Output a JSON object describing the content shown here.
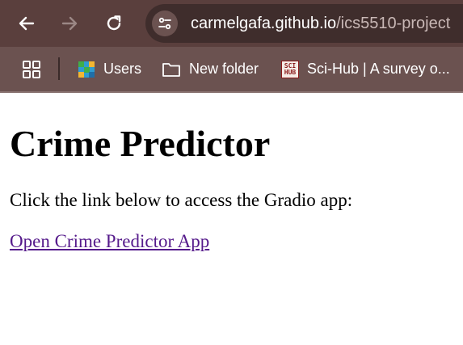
{
  "browser": {
    "url_host": "carmelgafa.github.io",
    "url_path": "/ics5510-project",
    "icons": [
      "back-arrow-icon",
      "forward-arrow-icon",
      "reload-icon",
      "site-info-icon"
    ],
    "colors": {
      "toolbar": "#5a3f3d",
      "bookmarks_bar": "#6b5250",
      "omnibox": "#3f2d2c"
    }
  },
  "bookmarks": {
    "items": [
      {
        "icon": "apps-grid-icon"
      },
      {
        "icon": "users-favicon",
        "label": "Users"
      },
      {
        "icon": "folder-icon",
        "label": "New folder"
      },
      {
        "icon": "scihub-favicon",
        "label": "Sci-Hub | A survey o..."
      }
    ],
    "scihub_logo_text": [
      "SCI",
      "HUB"
    ]
  },
  "page": {
    "title": "Crime Predictor",
    "intro": "Click the link below to access the Gradio app:",
    "link_text": "Open Crime Predictor App",
    "link_color": "#551a8b"
  }
}
